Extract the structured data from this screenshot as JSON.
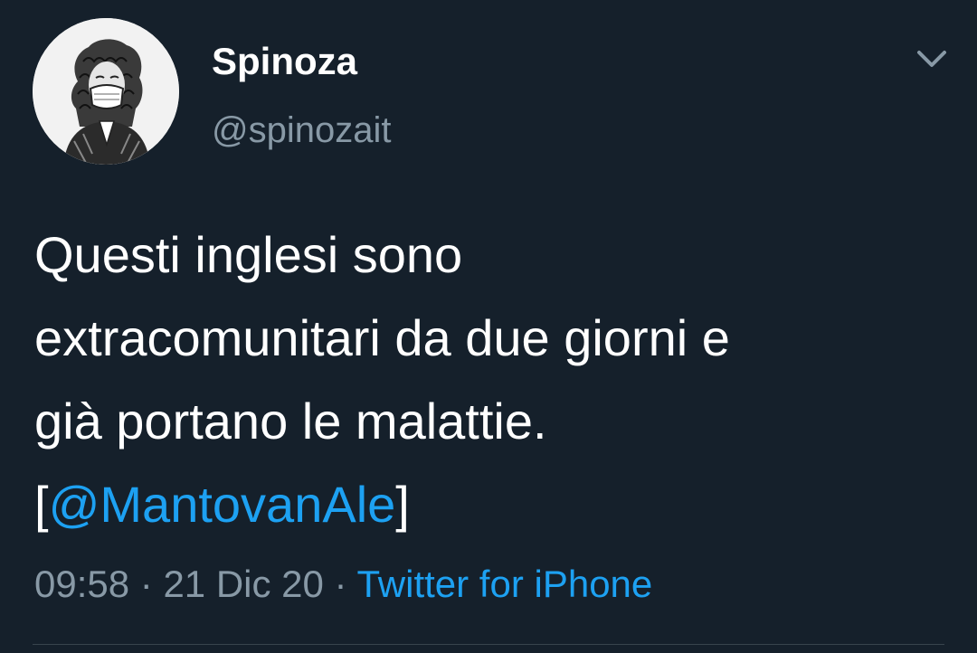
{
  "user": {
    "display_name": "Spinoza",
    "handle": "@spinozait"
  },
  "tweet": {
    "line1": "Questi inglesi sono",
    "line2": "extracomunitari da due giorni e",
    "line3": "già portano le malattie.",
    "bracket_open": "[",
    "mention": "@MantovanAle",
    "bracket_close": "]"
  },
  "meta": {
    "time": "09:58",
    "sep1": " · ",
    "date": "21 Dic 20",
    "sep2": " · ",
    "source": "Twitter for iPhone"
  },
  "icons": {
    "avatar": "masked-philosopher-engraving",
    "menu": "chevron-down-icon"
  },
  "colors": {
    "background": "#15202b",
    "text": "#ffffff",
    "secondary": "#8899a6",
    "link": "#1da1f2"
  }
}
